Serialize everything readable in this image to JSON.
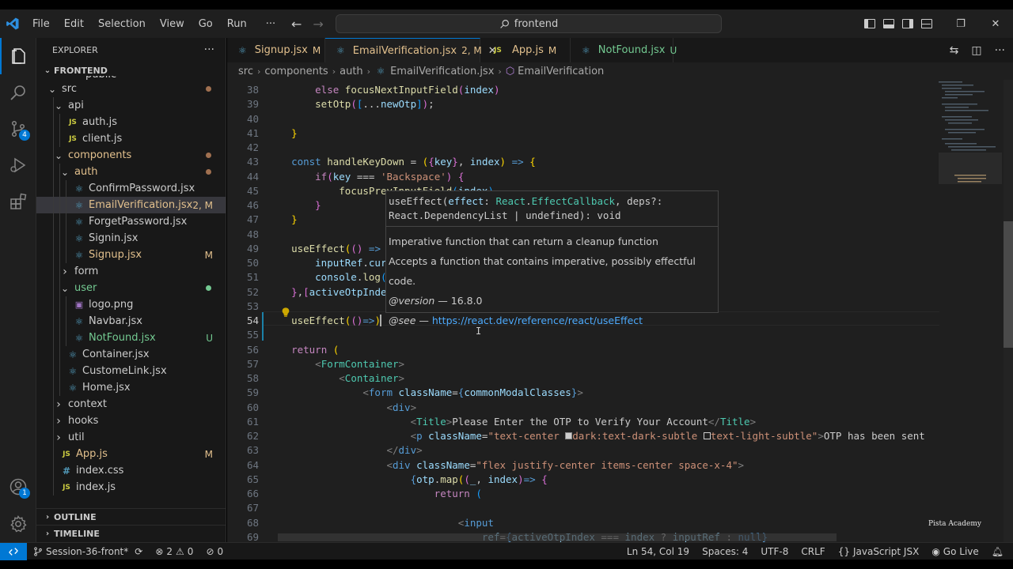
{
  "menu": [
    "File",
    "Edit",
    "Selection",
    "View",
    "Go",
    "Run",
    "···"
  ],
  "command_center": "frontend",
  "window_controls": {
    "minimize": "—",
    "restore": "❐",
    "close": "✕"
  },
  "activity_badges": {
    "source_control": "4",
    "accounts": "1"
  },
  "explorer": {
    "title": "EXPLORER",
    "more": "···",
    "root": "FRONTEND",
    "cut_item": "public",
    "tree": [
      {
        "label": "src",
        "depth": 0,
        "kind": "folder",
        "open": true,
        "status": "dot"
      },
      {
        "label": "api",
        "depth": 1,
        "kind": "folder",
        "open": true
      },
      {
        "label": "auth.js",
        "depth": 2,
        "kind": "js"
      },
      {
        "label": "client.js",
        "depth": 2,
        "kind": "js"
      },
      {
        "label": "components",
        "depth": 1,
        "kind": "folder",
        "open": true,
        "status": "dot",
        "modified": true
      },
      {
        "label": "auth",
        "depth": 2,
        "kind": "folder",
        "open": true,
        "status": "dot",
        "modified": true
      },
      {
        "label": "ConfirmPassword.jsx",
        "depth": 3,
        "kind": "jsx"
      },
      {
        "label": "EmailVerification.jsx",
        "depth": 3,
        "kind": "jsx",
        "selected": true,
        "modified": true,
        "trail": "2, M"
      },
      {
        "label": "ForgetPassword.jsx",
        "depth": 3,
        "kind": "jsx"
      },
      {
        "label": "Signin.jsx",
        "depth": 3,
        "kind": "jsx"
      },
      {
        "label": "Signup.jsx",
        "depth": 3,
        "kind": "jsx",
        "modified": true,
        "trail": "M"
      },
      {
        "label": "form",
        "depth": 2,
        "kind": "folder",
        "open": false
      },
      {
        "label": "user",
        "depth": 2,
        "kind": "folder",
        "open": true,
        "status": "dotgreen",
        "untracked": true
      },
      {
        "label": "logo.png",
        "depth": 3,
        "kind": "png"
      },
      {
        "label": "Navbar.jsx",
        "depth": 3,
        "kind": "jsx"
      },
      {
        "label": "NotFound.jsx",
        "depth": 3,
        "kind": "jsx",
        "untracked": true,
        "trail": "U"
      },
      {
        "label": "Container.jsx",
        "depth": 2,
        "kind": "jsx"
      },
      {
        "label": "CustomeLink.jsx",
        "depth": 2,
        "kind": "jsx"
      },
      {
        "label": "Home.jsx",
        "depth": 2,
        "kind": "jsx"
      },
      {
        "label": "context",
        "depth": 1,
        "kind": "folder",
        "open": false
      },
      {
        "label": "hooks",
        "depth": 1,
        "kind": "folder",
        "open": false
      },
      {
        "label": "util",
        "depth": 1,
        "kind": "folder",
        "open": false
      },
      {
        "label": "App.js",
        "depth": 1,
        "kind": "js",
        "modified": true,
        "trail": "M"
      },
      {
        "label": "index.css",
        "depth": 1,
        "kind": "css"
      },
      {
        "label": "index.js",
        "depth": 1,
        "kind": "js"
      }
    ],
    "outline": "OUTLINE",
    "timeline": "TIMELINE"
  },
  "tabs": [
    {
      "label": "Signup.jsx",
      "status": "M",
      "kind": "jsx",
      "active": false,
      "cls": "mod"
    },
    {
      "label": "EmailVerification.jsx",
      "status": "2, M",
      "kind": "jsx",
      "active": true,
      "cls": "mod"
    },
    {
      "label": "App.js",
      "status": "M",
      "kind": "js",
      "active": false,
      "cls": "mod"
    },
    {
      "label": "NotFound.jsx",
      "status": "U",
      "kind": "jsx",
      "active": false,
      "cls": "untr"
    }
  ],
  "breadcrumb": [
    "src",
    "components",
    "auth",
    "EmailVerification.jsx",
    "EmailVerification"
  ],
  "current_line": 54,
  "code": [
    {
      "n": 38,
      "h": "      <span class=\"c\">else</span> <span class=\"f\">focusNextInputField</span><span class=\"p\">(</span><span class=\"v\">index</span><span class=\"p\">)</span>"
    },
    {
      "n": 39,
      "h": "      <span class=\"f\">setOtp</span><span class=\"p\">(</span><span class=\"q\">[</span>...<span class=\"v\">newOtp</span><span class=\"q\">]</span><span class=\"p\">)</span>;"
    },
    {
      "n": 40,
      "h": ""
    },
    {
      "n": 41,
      "h": "  <span class=\"b\">}</span>"
    },
    {
      "n": 42,
      "h": ""
    },
    {
      "n": 43,
      "h": "  <span class=\"k\">const</span> <span class=\"f\">handleKeyDown</span> = <span class=\"b\">(</span><span class=\"p\">{</span><span class=\"v\">key</span><span class=\"p\">}</span>, <span class=\"v\">index</span><span class=\"b\">)</span> <span class=\"k\">=&gt;</span> <span class=\"b\">{</span>"
    },
    {
      "n": 44,
      "h": "      <span class=\"c\">if</span><span class=\"p\">(</span><span class=\"v\">key</span> === <span class=\"s\">'Backspace'</span><span class=\"p\">)</span> <span class=\"p\">{</span>"
    },
    {
      "n": 45,
      "h": "          <span class=\"f\">focusPrevInputField</span><span class=\"q\">(</span><span class=\"v\">index</span><span class=\"q\">)</span>"
    },
    {
      "n": 46,
      "h": "      <span class=\"p\">}</span>"
    },
    {
      "n": 47,
      "h": "  <span class=\"b\">}</span>"
    },
    {
      "n": 48,
      "h": ""
    },
    {
      "n": 49,
      "h": "  <span class=\"f\">useEffect</span><span class=\"b\">(</span><span class=\"p\">()</span> <span class=\"k\">=&gt;</span> <span class=\"p\">{</span>"
    },
    {
      "n": 50,
      "h": "      <span class=\"v\">inputRef</span>.<span class=\"v\">current</span>?.<span class=\"f\">focus</span><span class=\"q\">()</span>"
    },
    {
      "n": 51,
      "h": "      <span class=\"v\">console</span>.<span class=\"f\">log</span><span class=\"q\">(</span><span class=\"v\">inputRef</span><span class=\"q\">)</span>"
    },
    {
      "n": 52,
      "h": "  <span class=\"p\">}</span>,<span class=\"p\">[</span><span class=\"v\">activeOtpIndex</span><span class=\"p\">]</span><span class=\"b\">)</span>"
    },
    {
      "n": 53,
      "h": ""
    },
    {
      "n": 54,
      "h": "  <span class=\"f\">useEffect</span><span class=\"b\">(</span><span class=\"p\">()</span><span class=\"k\">=&gt;</span><span class=\"b\">)</span>"
    },
    {
      "n": 55,
      "h": ""
    },
    {
      "n": 56,
      "h": "  <span class=\"c\">return</span> <span class=\"b\">(</span>"
    },
    {
      "n": 57,
      "h": "      <span class=\"g\">&lt;</span><span class=\"t\">FormContainer</span><span class=\"g\">&gt;</span>"
    },
    {
      "n": 58,
      "h": "          <span class=\"g\">&lt;</span><span class=\"t\">Container</span><span class=\"g\">&gt;</span>"
    },
    {
      "n": 59,
      "h": "              <span class=\"g\">&lt;</span><span class=\"k\">form</span> <span class=\"v\">className</span>=<span class=\"k\">{</span><span class=\"v\">commonModalClasses</span><span class=\"k\">}</span><span class=\"g\">&gt;</span>"
    },
    {
      "n": 60,
      "h": "                  <span class=\"g\">&lt;</span><span class=\"k\">div</span><span class=\"g\">&gt;</span>"
    },
    {
      "n": 61,
      "h": "                      <span class=\"g\">&lt;</span><span class=\"t\">Title</span><span class=\"g\">&gt;</span>Please Enter the OTP to Verify Your Account<span class=\"g\">&lt;/</span><span class=\"t\">Title</span><span class=\"g\">&gt;</span>"
    },
    {
      "n": 62,
      "h": "                      <span class=\"g\">&lt;</span><span class=\"k\">p</span> <span class=\"v\">className</span>=<span class=\"s\">\"text-center <span style=\"display:inline-block;width:9px;height:9px;background:#cccccc;border:1px solid #888;\"></span>dark:text-dark-subtle <span style=\"display:inline-block;width:9px;height:9px;background:#1f1f1f;border:1px solid #ccc;\"></span>text-light-subtle\"</span><span class=\"g\">&gt;</span>OTP has been sent"
    },
    {
      "n": 63,
      "h": "                  <span class=\"g\">&lt;/</span><span class=\"k\">div</span><span class=\"g\">&gt;</span>"
    },
    {
      "n": 64,
      "h": "                  <span class=\"g\">&lt;</span><span class=\"k\">div</span> <span class=\"v\">className</span>=<span class=\"s\">\"flex justify-center items-center space-x-4\"</span><span class=\"g\">&gt;</span>"
    },
    {
      "n": 65,
      "h": "                      <span class=\"k\">{</span><span class=\"v\">otp</span>.<span class=\"f\">map</span><span class=\"b\">(</span><span class=\"p\">(</span><span class=\"v\">_</span>, <span class=\"v\">index</span><span class=\"p\">)</span><span class=\"k\">=&gt;</span> <span class=\"p\">{</span>"
    },
    {
      "n": 66,
      "h": "                          <span class=\"c\">return</span> <span class=\"q\">(</span>"
    },
    {
      "n": 67,
      "h": ""
    },
    {
      "n": 68,
      "h": "                              <span class=\"g\">&lt;</span><span class=\"k\">input</span>"
    },
    {
      "n": 69,
      "h": "                                  <span class=\"v\">ref</span>=<span class=\"k\">{</span><span class=\"v\">activeOtpIndex</span> === <span class=\"v\">index</span> ? <span class=\"v\">inputRef</span> : <span class=\"k\">null</span><span class=\"k\">}</span>"
    }
  ],
  "hover": {
    "signature_html": "useEffect(<span class=\"v\">effect</span>: <span class=\"t\">React</span>.<span class=\"t\">EffectCallback</span>, deps?:<br>React.DependencyList | undefined): void",
    "line1": "Imperative function that can return a cleanup function",
    "line2": "Accepts a function that contains imperative, possibly effectful code.",
    "version_tag": "@version",
    "version_value": " — 16.8.0",
    "see_tag": "@see",
    "see_dash": " — ",
    "see_link": "https://react.dev/reference/react/useEffect"
  },
  "watermark": "Pista Academy",
  "status": {
    "branch": "Session-36-front*",
    "errors": "2",
    "warnings": "0",
    "ports": "0",
    "position": "Ln 54, Col 19",
    "spaces": "Spaces: 4",
    "encoding": "UTF-8",
    "eol": "CRLF",
    "language": "JavaScript JSX",
    "golive": "Go Live"
  }
}
